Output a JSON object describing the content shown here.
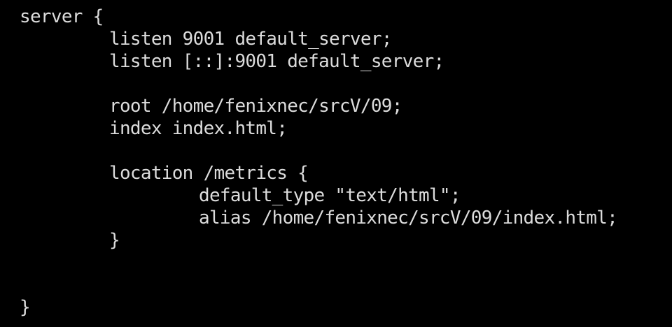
{
  "terminal": {
    "lines": [
      "server {",
      "listen 9001 default_server;",
      "listen [::]:9001 default_server;",
      "root /home/fenixnec/srcV/09;",
      "index index.html;",
      "location /metrics {",
      "default_type \"text/html\";",
      "alias /home/fenixnec/srcV/09/index.html;",
      "}",
      "}"
    ],
    "colors": {
      "background": "#000000",
      "foreground": "#dcdcdc"
    }
  }
}
